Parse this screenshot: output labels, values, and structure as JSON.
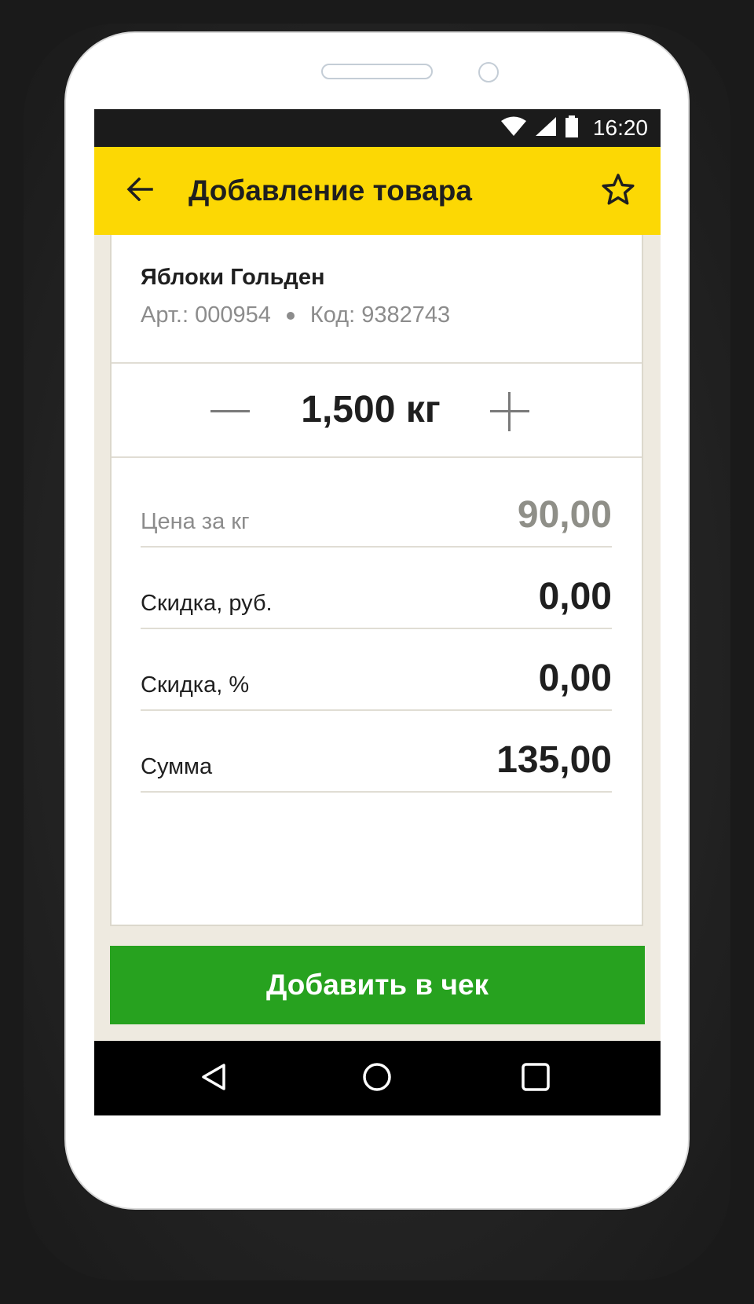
{
  "status_bar": {
    "time": "16:20",
    "icons": [
      "wifi-icon",
      "signal-icon",
      "battery-icon"
    ]
  },
  "app_bar": {
    "title": "Добавление товара",
    "back_icon": "arrow-left-icon",
    "favorite_icon": "star-outline-icon",
    "background_color": "#fcd804"
  },
  "product": {
    "name": "Яблоки Гольден",
    "article": "Арт.: 000954",
    "code": "Код: 9382743"
  },
  "quantity": {
    "value": "1,500 кг",
    "decrement_icon": "minus-icon",
    "increment_icon": "plus-icon"
  },
  "fields": [
    {
      "label": "Цена за кг",
      "value": "90,00"
    },
    {
      "label": "Скидка, руб.",
      "value": "0,00"
    },
    {
      "label": "Скидка, %",
      "value": "0,00"
    },
    {
      "label": "Сумма",
      "value": "135,00"
    }
  ],
  "add_button": {
    "label": "Добавить в чек",
    "color": "#27a21f"
  },
  "nav_bar": {
    "icons": [
      "back-triangle-icon",
      "home-circle-icon",
      "recents-square-icon"
    ]
  }
}
